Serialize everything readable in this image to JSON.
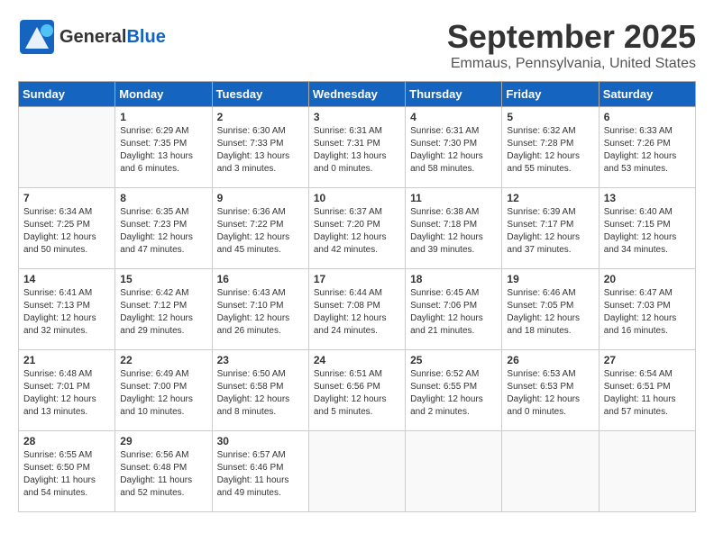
{
  "header": {
    "logo": {
      "general": "General",
      "blue": "Blue"
    },
    "title": "September 2025",
    "location": "Emmaus, Pennsylvania, United States"
  },
  "calendar": {
    "weekdays": [
      "Sunday",
      "Monday",
      "Tuesday",
      "Wednesday",
      "Thursday",
      "Friday",
      "Saturday"
    ],
    "weeks": [
      [
        {
          "day": "",
          "empty": true
        },
        {
          "day": "1",
          "sunrise": "Sunrise: 6:29 AM",
          "sunset": "Sunset: 7:35 PM",
          "daylight": "Daylight: 13 hours and 6 minutes."
        },
        {
          "day": "2",
          "sunrise": "Sunrise: 6:30 AM",
          "sunset": "Sunset: 7:33 PM",
          "daylight": "Daylight: 13 hours and 3 minutes."
        },
        {
          "day": "3",
          "sunrise": "Sunrise: 6:31 AM",
          "sunset": "Sunset: 7:31 PM",
          "daylight": "Daylight: 13 hours and 0 minutes."
        },
        {
          "day": "4",
          "sunrise": "Sunrise: 6:31 AM",
          "sunset": "Sunset: 7:30 PM",
          "daylight": "Daylight: 12 hours and 58 minutes."
        },
        {
          "day": "5",
          "sunrise": "Sunrise: 6:32 AM",
          "sunset": "Sunset: 7:28 PM",
          "daylight": "Daylight: 12 hours and 55 minutes."
        },
        {
          "day": "6",
          "sunrise": "Sunrise: 6:33 AM",
          "sunset": "Sunset: 7:26 PM",
          "daylight": "Daylight: 12 hours and 53 minutes."
        }
      ],
      [
        {
          "day": "7",
          "sunrise": "Sunrise: 6:34 AM",
          "sunset": "Sunset: 7:25 PM",
          "daylight": "Daylight: 12 hours and 50 minutes."
        },
        {
          "day": "8",
          "sunrise": "Sunrise: 6:35 AM",
          "sunset": "Sunset: 7:23 PM",
          "daylight": "Daylight: 12 hours and 47 minutes."
        },
        {
          "day": "9",
          "sunrise": "Sunrise: 6:36 AM",
          "sunset": "Sunset: 7:22 PM",
          "daylight": "Daylight: 12 hours and 45 minutes."
        },
        {
          "day": "10",
          "sunrise": "Sunrise: 6:37 AM",
          "sunset": "Sunset: 7:20 PM",
          "daylight": "Daylight: 12 hours and 42 minutes."
        },
        {
          "day": "11",
          "sunrise": "Sunrise: 6:38 AM",
          "sunset": "Sunset: 7:18 PM",
          "daylight": "Daylight: 12 hours and 39 minutes."
        },
        {
          "day": "12",
          "sunrise": "Sunrise: 6:39 AM",
          "sunset": "Sunset: 7:17 PM",
          "daylight": "Daylight: 12 hours and 37 minutes."
        },
        {
          "day": "13",
          "sunrise": "Sunrise: 6:40 AM",
          "sunset": "Sunset: 7:15 PM",
          "daylight": "Daylight: 12 hours and 34 minutes."
        }
      ],
      [
        {
          "day": "14",
          "sunrise": "Sunrise: 6:41 AM",
          "sunset": "Sunset: 7:13 PM",
          "daylight": "Daylight: 12 hours and 32 minutes."
        },
        {
          "day": "15",
          "sunrise": "Sunrise: 6:42 AM",
          "sunset": "Sunset: 7:12 PM",
          "daylight": "Daylight: 12 hours and 29 minutes."
        },
        {
          "day": "16",
          "sunrise": "Sunrise: 6:43 AM",
          "sunset": "Sunset: 7:10 PM",
          "daylight": "Daylight: 12 hours and 26 minutes."
        },
        {
          "day": "17",
          "sunrise": "Sunrise: 6:44 AM",
          "sunset": "Sunset: 7:08 PM",
          "daylight": "Daylight: 12 hours and 24 minutes."
        },
        {
          "day": "18",
          "sunrise": "Sunrise: 6:45 AM",
          "sunset": "Sunset: 7:06 PM",
          "daylight": "Daylight: 12 hours and 21 minutes."
        },
        {
          "day": "19",
          "sunrise": "Sunrise: 6:46 AM",
          "sunset": "Sunset: 7:05 PM",
          "daylight": "Daylight: 12 hours and 18 minutes."
        },
        {
          "day": "20",
          "sunrise": "Sunrise: 6:47 AM",
          "sunset": "Sunset: 7:03 PM",
          "daylight": "Daylight: 12 hours and 16 minutes."
        }
      ],
      [
        {
          "day": "21",
          "sunrise": "Sunrise: 6:48 AM",
          "sunset": "Sunset: 7:01 PM",
          "daylight": "Daylight: 12 hours and 13 minutes."
        },
        {
          "day": "22",
          "sunrise": "Sunrise: 6:49 AM",
          "sunset": "Sunset: 7:00 PM",
          "daylight": "Daylight: 12 hours and 10 minutes."
        },
        {
          "day": "23",
          "sunrise": "Sunrise: 6:50 AM",
          "sunset": "Sunset: 6:58 PM",
          "daylight": "Daylight: 12 hours and 8 minutes."
        },
        {
          "day": "24",
          "sunrise": "Sunrise: 6:51 AM",
          "sunset": "Sunset: 6:56 PM",
          "daylight": "Daylight: 12 hours and 5 minutes."
        },
        {
          "day": "25",
          "sunrise": "Sunrise: 6:52 AM",
          "sunset": "Sunset: 6:55 PM",
          "daylight": "Daylight: 12 hours and 2 minutes."
        },
        {
          "day": "26",
          "sunrise": "Sunrise: 6:53 AM",
          "sunset": "Sunset: 6:53 PM",
          "daylight": "Daylight: 12 hours and 0 minutes."
        },
        {
          "day": "27",
          "sunrise": "Sunrise: 6:54 AM",
          "sunset": "Sunset: 6:51 PM",
          "daylight": "Daylight: 11 hours and 57 minutes."
        }
      ],
      [
        {
          "day": "28",
          "sunrise": "Sunrise: 6:55 AM",
          "sunset": "Sunset: 6:50 PM",
          "daylight": "Daylight: 11 hours and 54 minutes."
        },
        {
          "day": "29",
          "sunrise": "Sunrise: 6:56 AM",
          "sunset": "Sunset: 6:48 PM",
          "daylight": "Daylight: 11 hours and 52 minutes."
        },
        {
          "day": "30",
          "sunrise": "Sunrise: 6:57 AM",
          "sunset": "Sunset: 6:46 PM",
          "daylight": "Daylight: 11 hours and 49 minutes."
        },
        {
          "day": "",
          "empty": true
        },
        {
          "day": "",
          "empty": true
        },
        {
          "day": "",
          "empty": true
        },
        {
          "day": "",
          "empty": true
        }
      ]
    ]
  }
}
